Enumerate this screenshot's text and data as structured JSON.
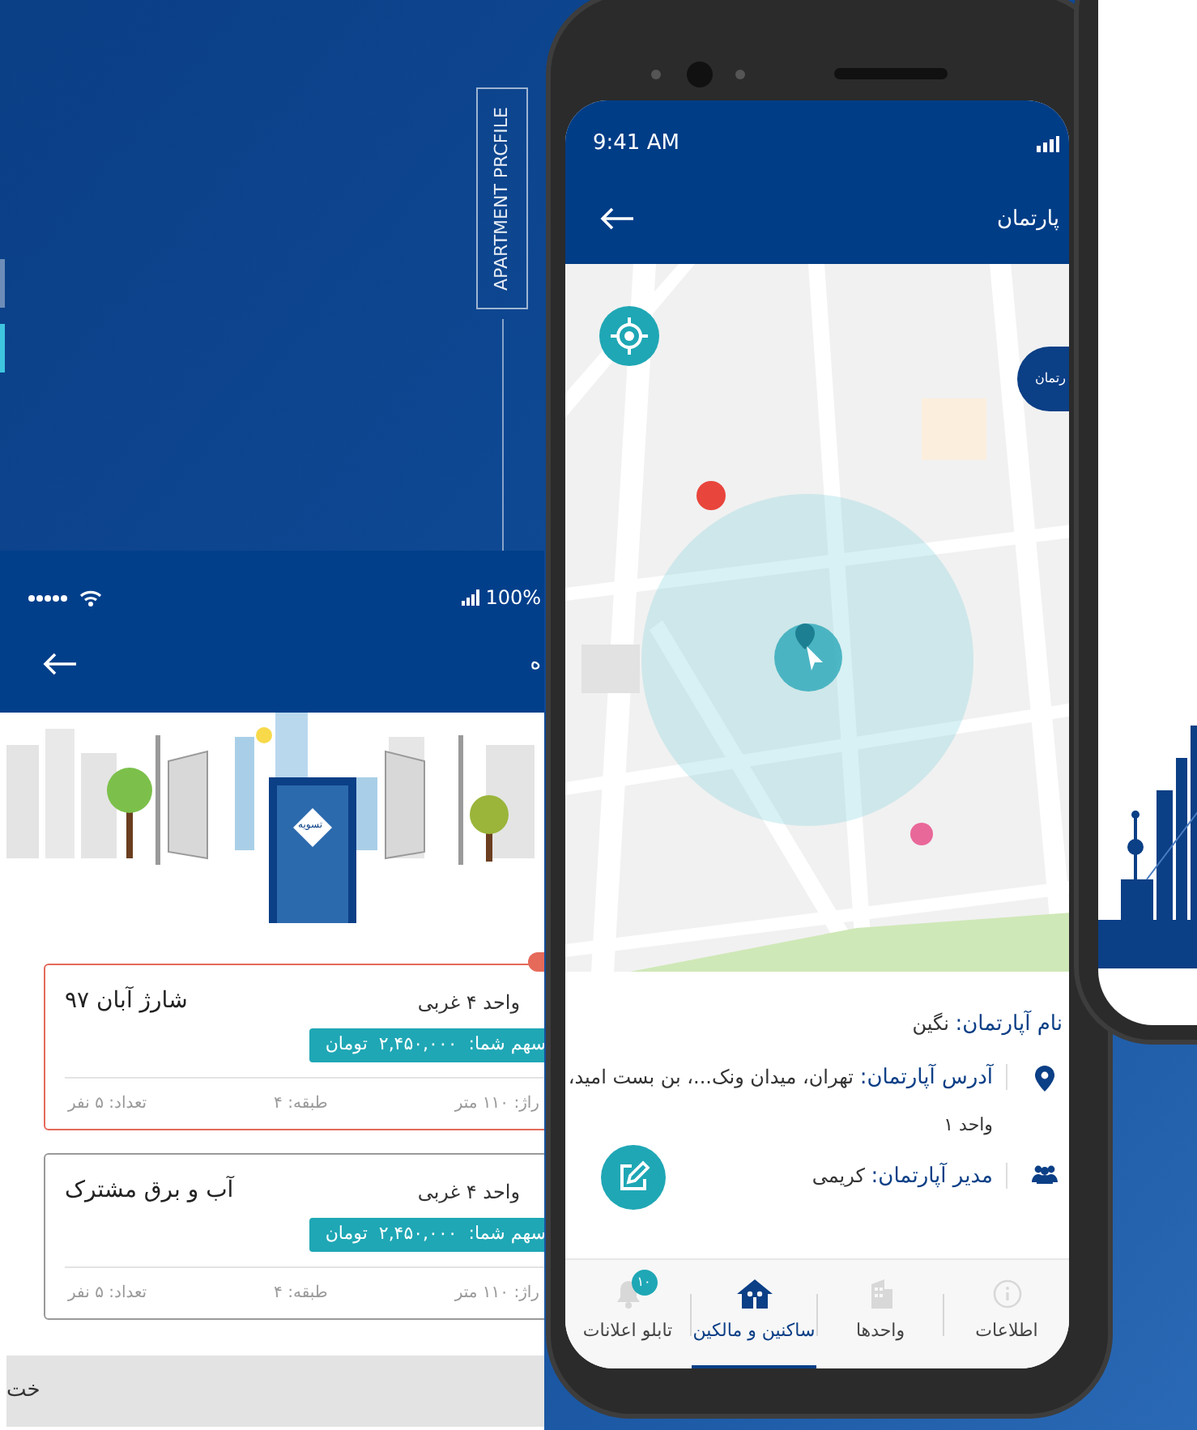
{
  "background_label": "APARTMENT PRCFILE",
  "left_screen": {
    "status_bar": {
      "battery": "100%"
    },
    "header": {
      "title": "ه"
    },
    "door_sign": "تسویه",
    "cards": [
      {
        "title": "شارژ آبان ۹۷",
        "unit": "واحد ۴ غربی",
        "share": "سهم شما:  ۲,۴۵۰,۰۰۰  تومان",
        "area": "راژ: ۱۱۰ متر",
        "floor": "طبقه: ۴",
        "count": "تعداد: ۵ نفر",
        "selected": true
      },
      {
        "title": "آب و برق مشترک",
        "unit": "واحد ۴ غربی",
        "share": "سهم شما:  ۲,۴۵۰,۰۰۰  تومان",
        "area": "راژ: ۱۱۰ متر",
        "floor": "طبقه: ۴",
        "count": "تعداد: ۵ نفر",
        "selected": false
      }
    ],
    "bottom_button": "خت"
  },
  "main_phone": {
    "status_bar": {
      "time": "9:41 AM"
    },
    "header": {
      "title": "پارتمان"
    },
    "map": {
      "kind": "picture",
      "marker_label": "رتمان"
    },
    "info": [
      {
        "kind": "name",
        "label": "نام آپارتمان:",
        "value": "نگین"
      },
      {
        "kind": "address",
        "label": "آدرس آپارتمان:",
        "value": "تهران، میدان ونک...، بن بست امید،",
        "continuation": "واحد ۱"
      },
      {
        "kind": "manager",
        "label": "مدیر آپارتمان:",
        "value": "کریمی"
      }
    ],
    "tabs": [
      {
        "label": "اطلاعات",
        "selected": false
      },
      {
        "label": "واحدها",
        "selected": false
      },
      {
        "label": "ساکنین و مالکین",
        "selected": true
      },
      {
        "label": "تابلو اعلانات",
        "selected": false,
        "badge": "۱۰"
      }
    ]
  }
}
